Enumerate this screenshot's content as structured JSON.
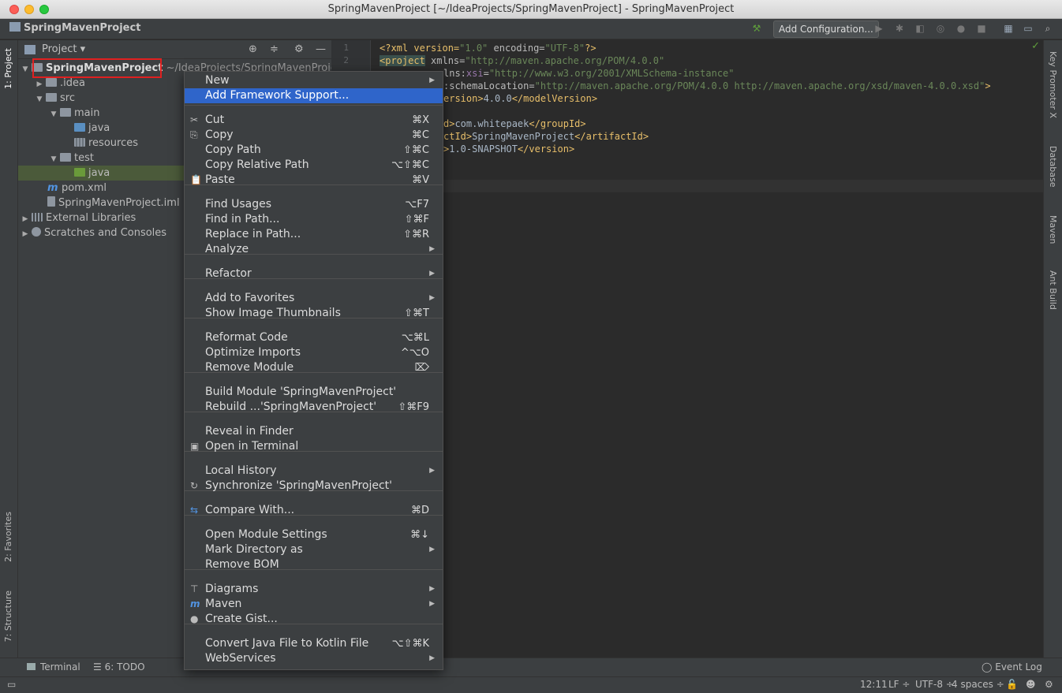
{
  "window": {
    "title": "SpringMavenProject [~/IdeaProjects/SpringMavenProject] - SpringMavenProject"
  },
  "navbar": {
    "project_name": "SpringMavenProject",
    "add_config_label": "Add Configuration..."
  },
  "left_tabs": {
    "project": "1: Project",
    "favorites": "2: Favorites",
    "structure": "7: Structure"
  },
  "right_tabs": {
    "key_promoter": "Key Promoter X",
    "database": "Database",
    "maven": "Maven",
    "ant": "Ant Build"
  },
  "project_panel": {
    "header": "Project",
    "tree": {
      "root": {
        "name": "SpringMavenProject",
        "path": "~/IdeaProjects/SpringMavenProject"
      },
      "idea": ".idea",
      "src": "src",
      "main": "main",
      "main_java": "java",
      "resources": "resources",
      "test": "test",
      "test_java": "java",
      "pom": "pom.xml",
      "iml": "SpringMavenProject.iml",
      "ext_libs": "External Libraries",
      "scratches": "Scratches and Consoles"
    }
  },
  "editor": {
    "line_numbers": [
      "1",
      "2"
    ],
    "code": [
      {
        "p1": "<?xml version=",
        "v": "\"1.0\"",
        "p2": " encoding=",
        "v2": "\"UTF-8\"",
        "p3": "?>"
      },
      {
        "tag": "<project",
        "att": " xmlns=",
        "v": "\"http://maven.apache.org/POM/4.0.0\""
      },
      {
        "att": "lns:",
        "ns": "xsi",
        "att2": "=",
        "v": "\"http://www.w3.org/2001/XMLSchema-instance\""
      },
      {
        "att": ":schemaLocation=",
        "v": "\"http://maven.apache.org/POM/4.0.0 http://maven.apache.org/xsd/maven-4.0.0.xsd\"",
        "tag": ">"
      },
      {
        "tag": "ersion>",
        "txt": "4.0.0",
        "tag2": "</modelVersion>"
      },
      {
        "tag": "d>",
        "txt": "com.whitepaek",
        "tag2": "</groupId>"
      },
      {
        "tag": "ctId>",
        "txt": "SpringMavenProject",
        "tag2": "</artifactId>"
      },
      {
        "tag": ">",
        "txt": "1.0-SNAPSHOT",
        "tag2": "</version>"
      }
    ]
  },
  "context_menu": {
    "items": [
      {
        "label": "New",
        "submenu": true
      },
      {
        "label": "Add Framework Support..."
      },
      {
        "label": "Cut",
        "shortcut": "⌘X"
      },
      {
        "label": "Copy",
        "shortcut": "⌘C"
      },
      {
        "label": "Copy Path",
        "shortcut": "⇧⌘C"
      },
      {
        "label": "Copy Relative Path",
        "shortcut": "⌥⇧⌘C"
      },
      {
        "label": "Paste",
        "shortcut": "⌘V"
      },
      {
        "label": "Find Usages",
        "shortcut": "⌥F7"
      },
      {
        "label": "Find in Path...",
        "shortcut": "⇧⌘F"
      },
      {
        "label": "Replace in Path...",
        "shortcut": "⇧⌘R"
      },
      {
        "label": "Analyze",
        "submenu": true
      },
      {
        "label": "Refactor",
        "submenu": true
      },
      {
        "label": "Add to Favorites",
        "submenu": true
      },
      {
        "label": "Show Image Thumbnails",
        "shortcut": "⇧⌘T"
      },
      {
        "label": "Reformat Code",
        "shortcut": "⌥⌘L"
      },
      {
        "label": "Optimize Imports",
        "shortcut": "^⌥O"
      },
      {
        "label": "Remove Module",
        "shortcut": "⌦"
      },
      {
        "label": "Build Module 'SpringMavenProject'"
      },
      {
        "label": "Rebuild ...'SpringMavenProject'",
        "shortcut": "⇧⌘F9"
      },
      {
        "label": "Reveal in Finder"
      },
      {
        "label": "Open in Terminal"
      },
      {
        "label": "Local History",
        "submenu": true
      },
      {
        "label": "Synchronize 'SpringMavenProject'"
      },
      {
        "label": "Compare With...",
        "shortcut": "⌘D"
      },
      {
        "label": "Open Module Settings",
        "shortcut": "⌘↓"
      },
      {
        "label": "Mark Directory as",
        "submenu": true
      },
      {
        "label": "Remove BOM"
      },
      {
        "label": "Diagrams",
        "submenu": true
      },
      {
        "label": "Maven",
        "submenu": true
      },
      {
        "label": "Create Gist..."
      },
      {
        "label": "Convert Java File to Kotlin File",
        "shortcut": "⌥⇧⌘K"
      },
      {
        "label": "WebServices",
        "submenu": true
      }
    ]
  },
  "bottom_tools": {
    "terminal": "Terminal",
    "todo": "6: TODO",
    "event_log": "Event Log"
  },
  "status": {
    "position": "12:11",
    "line_sep": "LF ÷",
    "encoding": "UTF-8 ÷",
    "indent": "4 spaces ÷"
  },
  "colors": {
    "accent": "#2f65ca",
    "highlight_box": "#e02020"
  }
}
